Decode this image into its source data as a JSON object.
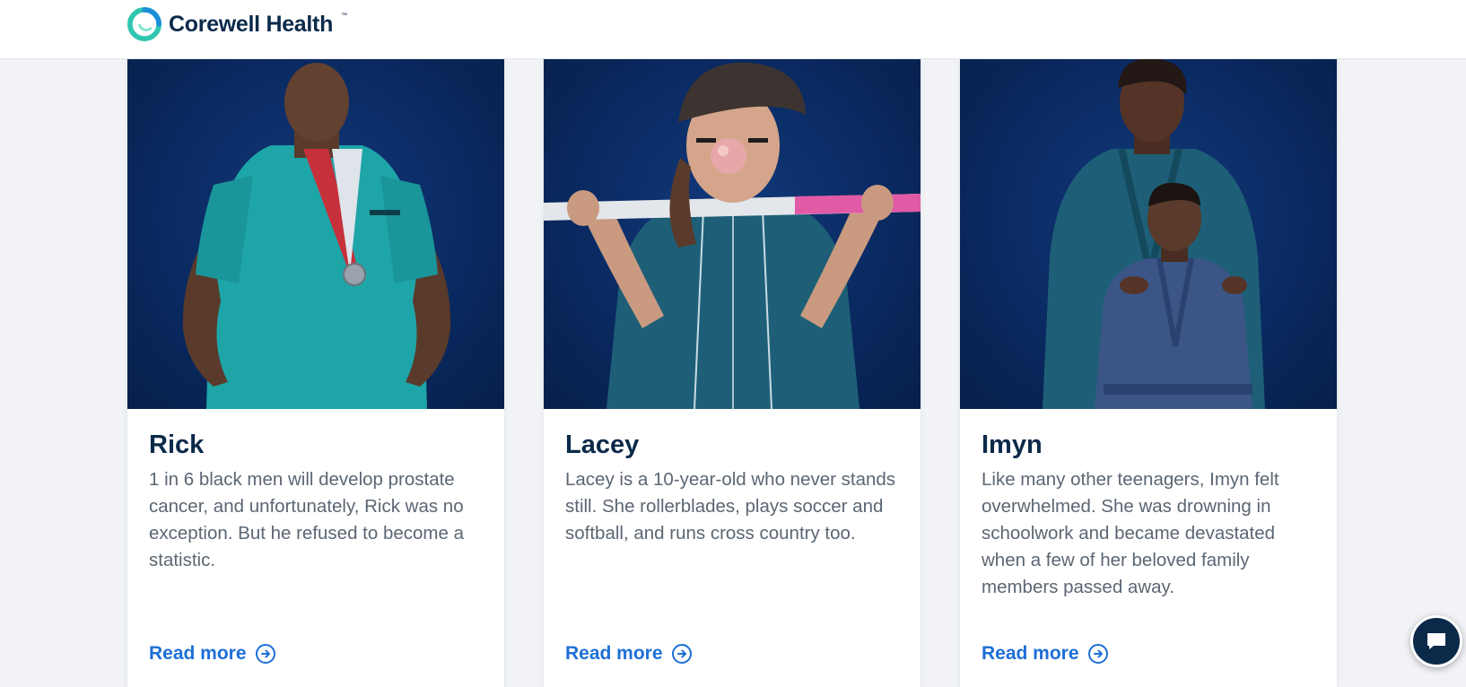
{
  "header": {
    "logo_text": "Corewell Health",
    "logo_tm": "™"
  },
  "cards": [
    {
      "name": "Rick",
      "description": "1 in 6 black men will develop prostate cancer, and unfortunately, Rick was no exception. But he refused to become a statistic.",
      "link_label": "Read more"
    },
    {
      "name": "Lacey",
      "description": "Lacey is a 10-year-old who never stands still. She rollerblades, plays soccer and softball, and runs cross country too.",
      "link_label": "Read more"
    },
    {
      "name": "Imyn",
      "description": "Like many other teenagers, Imyn felt overwhelmed. She was drowning in schoolwork and became devastated when a few of her beloved family members passed away.",
      "link_label": "Read more"
    }
  ],
  "colors": {
    "brand_navy": "#0b2a4a",
    "link_blue": "#1d6fd6",
    "body_text": "#5b6673",
    "photo_bg": "#0a2a62",
    "logo_teal": "#2fc6b0",
    "page_bg": "#f1f3f6"
  },
  "icons": {
    "logo": "corewell-swirl-icon",
    "read_more": "arrow-right-circle-icon",
    "chat": "chat-bubble-icon"
  }
}
